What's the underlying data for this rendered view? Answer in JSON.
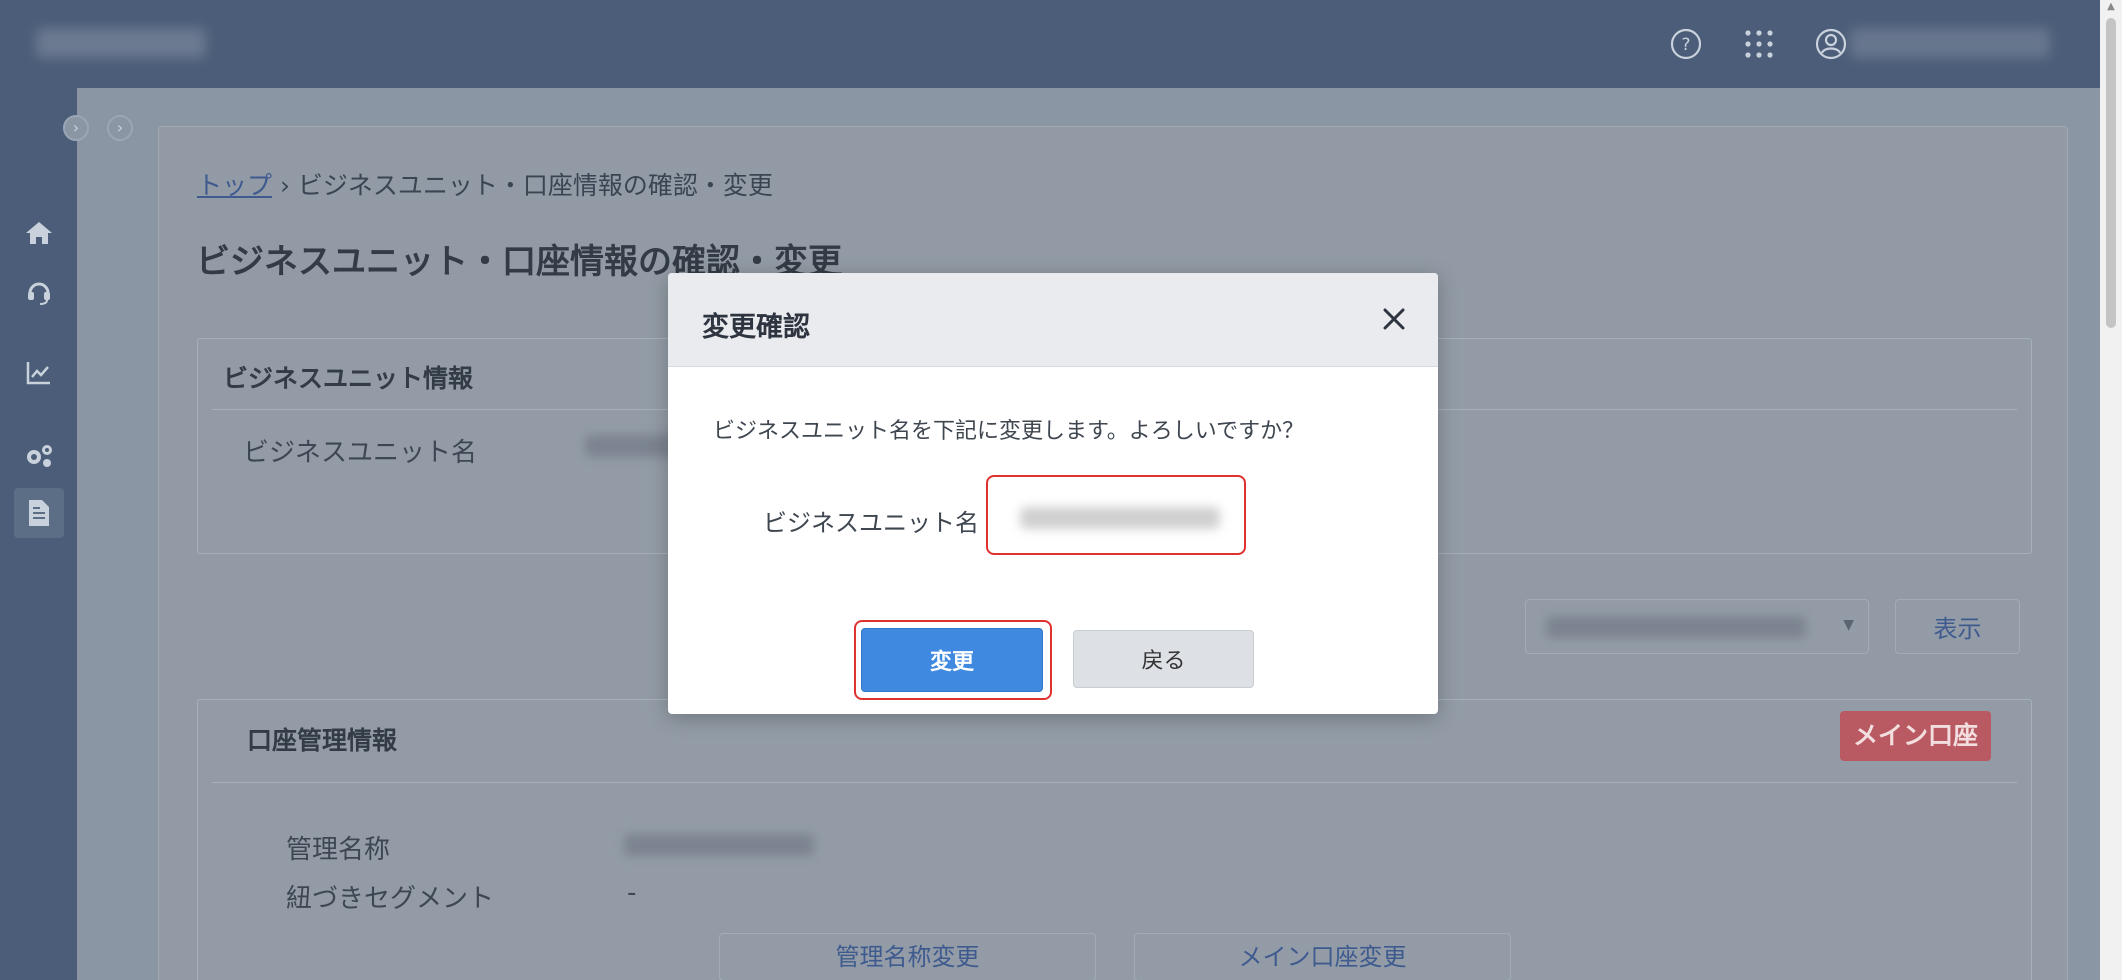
{
  "header": {
    "icons": [
      "help-icon",
      "app-grid-icon",
      "user-icon"
    ]
  },
  "sidebar": {
    "items": [
      {
        "icon": "home-icon"
      },
      {
        "icon": "support-icon"
      },
      {
        "icon": "chart-icon"
      },
      {
        "icon": "settings-icon"
      },
      {
        "icon": "document-icon",
        "active": true
      }
    ]
  },
  "breadcrumb": {
    "home": "トップ",
    "separator": "›",
    "current": "ビジネスユニット・口座情報の確認・変更"
  },
  "page": {
    "title": "ビジネスユニット・口座情報の確認・変更"
  },
  "business_unit_card": {
    "title": "ビジネスユニット情報",
    "name_label": "ビジネスユニット名"
  },
  "account_select": {
    "show_button": "表示"
  },
  "account_card": {
    "title": "口座管理情報",
    "badge": "メイン口座",
    "management_name_label": "管理名称",
    "linked_segment_label": "紐づきセグメント",
    "linked_segment_value": "-",
    "change_name_button": "管理名称変更",
    "change_main_button": "メイン口座変更"
  },
  "modal": {
    "title": "変更確認",
    "message": "ビジネスユニット名を下記に変更します。よろしいですか？",
    "field_label": "ビジネスユニット名",
    "confirm_button": "変更",
    "back_button": "戻る"
  },
  "colors": {
    "header": "#4b5d78",
    "primary": "#3f8ae0",
    "badge": "#b95a63",
    "highlight": "#e03131"
  }
}
